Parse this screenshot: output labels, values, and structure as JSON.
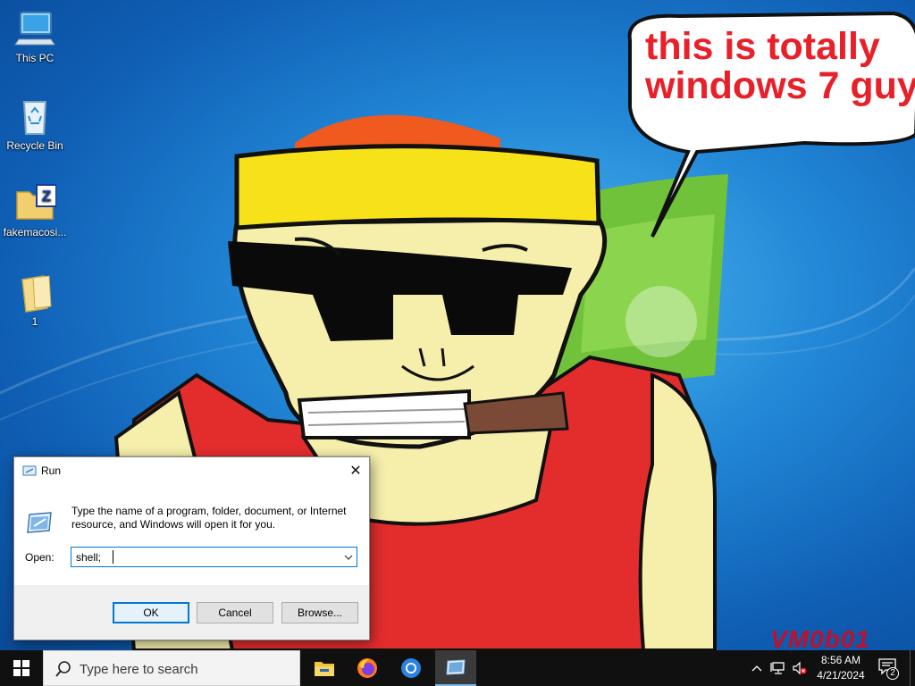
{
  "desktop": {
    "icons": [
      {
        "label": "This PC",
        "icon": "computer-icon"
      },
      {
        "label": "Recycle Bin",
        "icon": "recycle-bin-icon"
      },
      {
        "label": "fakemacosi...",
        "icon": "zip-archive-icon"
      },
      {
        "label": "1",
        "icon": "folder-icon"
      }
    ],
    "wallpaper": {
      "speech_bubble_line1": "this is totally",
      "speech_bubble_line2": "windows 7 guy",
      "watermark": "VM0b01"
    }
  },
  "run_dialog": {
    "title": "Run",
    "description": "Type the name of a program, folder, document, or Internet resource, and Windows will open it for you.",
    "open_label": "Open:",
    "open_value": "shell;",
    "ok_label": "OK",
    "cancel_label": "Cancel",
    "browse_label": "Browse...",
    "close_glyph": "✕"
  },
  "taskbar": {
    "search_placeholder": "Type here to search",
    "apps": [
      {
        "name": "File Explorer",
        "icon": "file-explorer-icon"
      },
      {
        "name": "Firefox",
        "icon": "firefox-icon"
      },
      {
        "name": "Chrome",
        "icon": "chrome-icon"
      },
      {
        "name": "Run",
        "icon": "run-icon",
        "active": true
      }
    ],
    "tray": {
      "time": "8:56 AM",
      "date": "4/21/2024",
      "notification_count": "2"
    }
  },
  "colors": {
    "accent": "#0078d7",
    "taskbar": "#101010",
    "bubble_text": "#e8202a"
  }
}
